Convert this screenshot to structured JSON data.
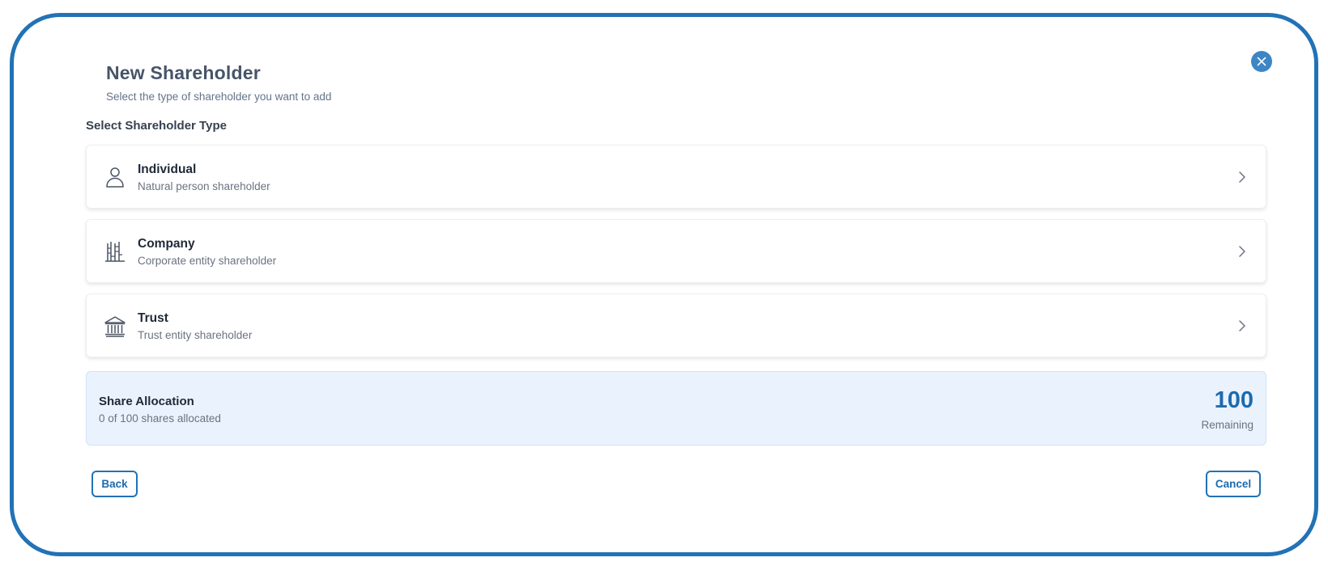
{
  "dialog": {
    "title": "New Shareholder",
    "subtitle": "Select the type of shareholder you want to add",
    "close_icon": "close-icon"
  },
  "section_label": "Select Shareholder Type",
  "options": [
    {
      "title": "Individual",
      "description": "Natural person shareholder",
      "icon": "person-icon"
    },
    {
      "title": "Company",
      "description": "Corporate entity shareholder",
      "icon": "building-icon"
    },
    {
      "title": "Trust",
      "description": "Trust entity shareholder",
      "icon": "bank-icon"
    }
  ],
  "allocation": {
    "title": "Share Allocation",
    "summary": "0 of 100 shares allocated",
    "remaining_value": "100",
    "remaining_label": "Remaining"
  },
  "footer": {
    "back_label": "Back",
    "cancel_label": "Cancel"
  },
  "colors": {
    "accent": "#2272b6",
    "allocation_background": "#eaf3fd"
  }
}
